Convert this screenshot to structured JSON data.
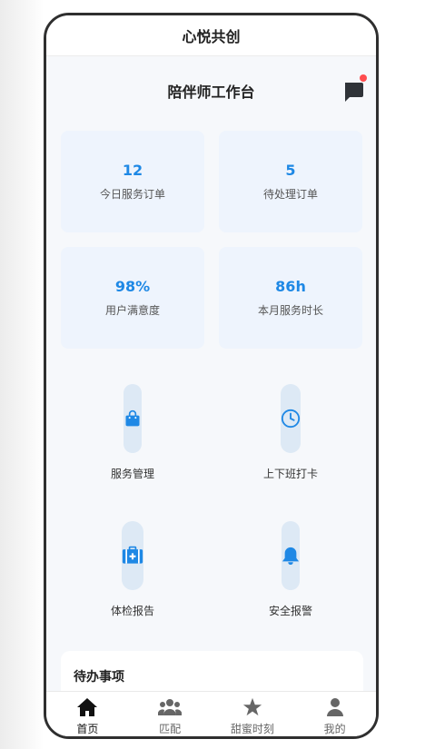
{
  "app": {
    "title": "心悦共创"
  },
  "header": {
    "title": "陪伴师工作台",
    "message_icon": "message-icon",
    "has_unread": true
  },
  "stats": [
    {
      "value": "12",
      "label": "今日服务订单"
    },
    {
      "value": "5",
      "label": "待处理订单"
    },
    {
      "value": "98%",
      "label": "用户满意度"
    },
    {
      "value": "86h",
      "label": "本月服务时长"
    }
  ],
  "functions": [
    {
      "label": "服务管理",
      "icon": "shopping-bag-icon"
    },
    {
      "label": "上下班打卡",
      "icon": "clock-icon"
    },
    {
      "label": "体检报告",
      "icon": "medical-kit-icon"
    },
    {
      "label": "安全报警",
      "icon": "bell-icon"
    }
  ],
  "todo": {
    "title": "待办事项"
  },
  "tabbar": {
    "items": [
      {
        "label": "首页",
        "icon": "home-icon",
        "active": true
      },
      {
        "label": "匹配",
        "icon": "users-icon",
        "active": false
      },
      {
        "label": "甜蜜时刻",
        "icon": "star-icon",
        "active": false
      },
      {
        "label": "我的",
        "icon": "user-icon",
        "active": false
      }
    ]
  },
  "colors": {
    "accent": "#1e88e5",
    "card_bg": "#eef4fd",
    "pill_bg": "#dde9f5",
    "badge": "#ff4d4f"
  }
}
